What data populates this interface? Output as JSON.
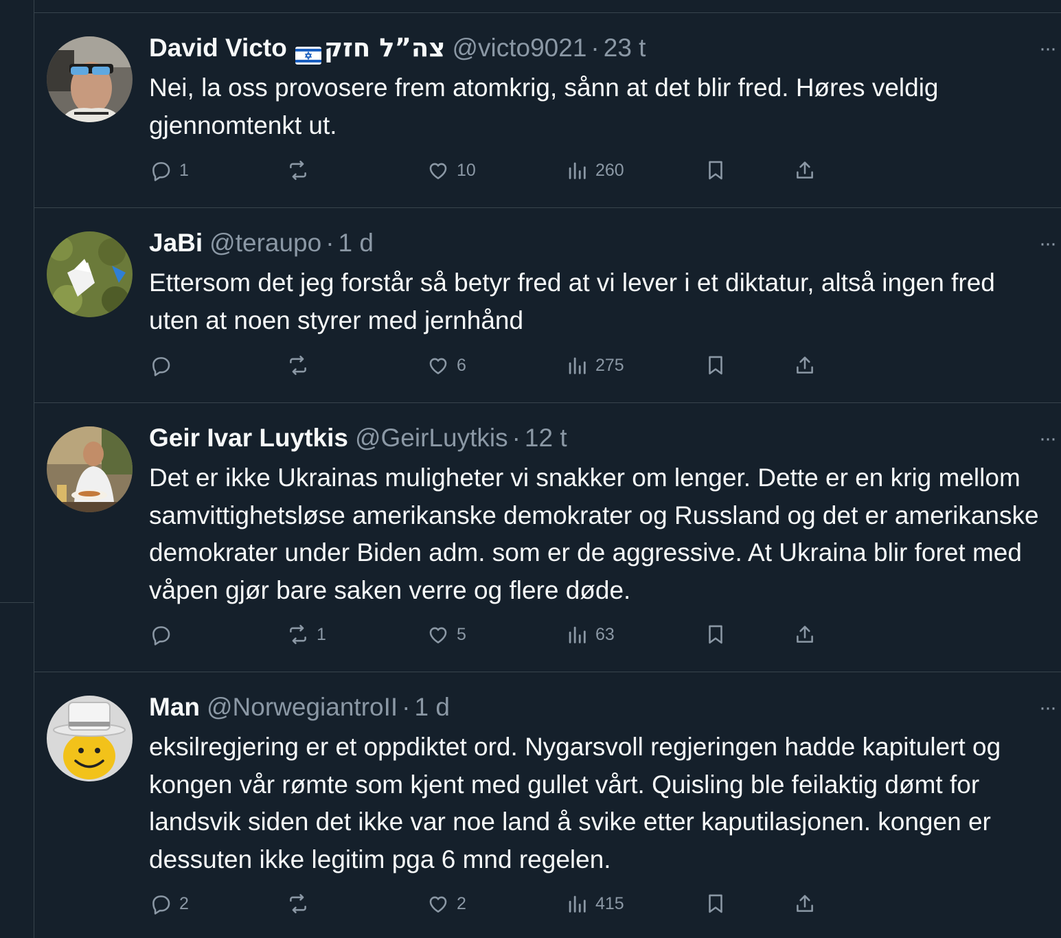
{
  "tweets": [
    {
      "name": "David Victo",
      "hebrew": "צה”ל חזק",
      "handle": "@victo9021",
      "separator": "·",
      "time": "23 t",
      "text": "Nei, la oss provosere frem atomkrig, sånn at det blir fred. Høres veldig gjennomtenkt ut.",
      "replies": "1",
      "retweets": "",
      "likes": "10",
      "views": "260",
      "more_label": "···"
    },
    {
      "name": "JaBi",
      "handle": "@teraupo",
      "separator": "·",
      "time": "1 d",
      "text": "Ettersom det jeg forstår så betyr fred at vi lever i et diktatur, altså ingen fred uten at noen styrer med jernhånd",
      "replies": "",
      "retweets": "",
      "likes": "6",
      "views": "275",
      "more_label": "···"
    },
    {
      "name": "Geir Ivar Luytkis",
      "handle": "@GeirLuytkis",
      "separator": "·",
      "time": "12 t",
      "text": "Det er ikke Ukrainas muligheter vi snakker om lenger. Dette er en krig mellom samvittighetsløse amerikanske demokrater og Russland og det er amerikanske demokrater under Biden adm. som er de aggressive. At Ukraina blir foret med våpen gjør bare saken verre og flere døde.",
      "replies": "",
      "retweets": "1",
      "likes": "5",
      "views": "63",
      "more_label": "···"
    },
    {
      "name": "Man",
      "handle": "@NorwegiantroII",
      "separator": "·",
      "time": "1 d",
      "text": "eksilregjering er et oppdiktet ord. Nygarsvoll regjeringen hadde kapitulert og kongen vår rømte som kjent med gullet vårt. Quisling ble feilaktig dømt for landsvik siden det ikke var noe land å svike etter kaputilasjonen. kongen er dessuten ikke legitim pga 6 mnd regelen.",
      "replies": "2",
      "retweets": "",
      "likes": "2",
      "views": "415",
      "more_label": "···"
    }
  ],
  "colors": {
    "background": "#15202b",
    "text": "#f7f9f9",
    "muted": "#8b98a5",
    "border": "#38444d"
  },
  "icons": [
    "reply-icon",
    "retweet-icon",
    "like-icon",
    "views-icon",
    "bookmark-icon",
    "share-icon",
    "more-icon",
    "israel-flag-icon"
  ]
}
